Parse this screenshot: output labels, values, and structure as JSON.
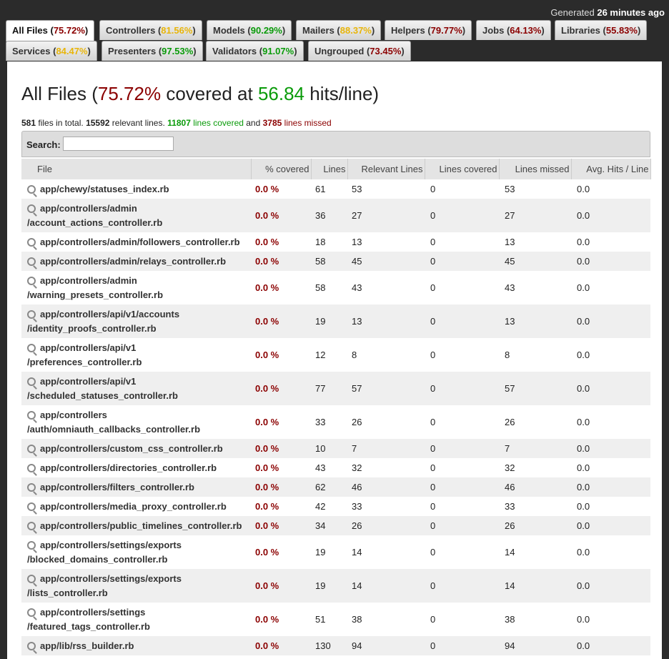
{
  "generated": {
    "prefix": "Generated ",
    "when": "26 minutes ago"
  },
  "tabs": [
    {
      "name": "All Files",
      "pct": "75.72%",
      "color": "red",
      "active": true
    },
    {
      "name": "Controllers",
      "pct": "81.56%",
      "color": "yel"
    },
    {
      "name": "Models",
      "pct": "90.29%",
      "color": "grn"
    },
    {
      "name": "Mailers",
      "pct": "88.37%",
      "color": "yel"
    },
    {
      "name": "Helpers",
      "pct": "79.77%",
      "color": "red"
    },
    {
      "name": "Jobs",
      "pct": "64.13%",
      "color": "red"
    },
    {
      "name": "Libraries",
      "pct": "55.83%",
      "color": "red"
    },
    {
      "name": "Services",
      "pct": "84.47%",
      "color": "yel"
    },
    {
      "name": "Presenters",
      "pct": "97.53%",
      "color": "grn"
    },
    {
      "name": "Validators",
      "pct": "91.07%",
      "color": "grn"
    },
    {
      "name": "Ungrouped",
      "pct": "73.45%",
      "color": "red"
    }
  ],
  "heading": {
    "prefix": "All Files (",
    "pct": "75.72%",
    "mid": " covered at ",
    "hits": "56.84",
    "suffix": " hits/line)"
  },
  "summary": {
    "files": "581",
    "files_label": " files in total. ",
    "relevant": "15592",
    "relevant_label": " relevant lines. ",
    "covered": "11807",
    "covered_label": " lines covered",
    "and": " and ",
    "missed": "3785",
    "missed_label": " lines missed"
  },
  "search": {
    "label": "Search:",
    "value": ""
  },
  "columns": [
    "File",
    "% covered",
    "Lines",
    "Relevant Lines",
    "Lines covered",
    "Lines missed",
    "Avg. Hits / Line"
  ],
  "rows": [
    {
      "file": [
        "app/chewy/statuses_index.rb"
      ],
      "cov": "0.0 %",
      "lines": "61",
      "rel": "53",
      "covd": "0",
      "miss": "53",
      "avg": "0.0"
    },
    {
      "file": [
        "app/controllers/admin",
        "/account_actions_controller.rb"
      ],
      "cov": "0.0 %",
      "lines": "36",
      "rel": "27",
      "covd": "0",
      "miss": "27",
      "avg": "0.0"
    },
    {
      "file": [
        "app/controllers/admin/followers_controller.rb"
      ],
      "cov": "0.0 %",
      "lines": "18",
      "rel": "13",
      "covd": "0",
      "miss": "13",
      "avg": "0.0"
    },
    {
      "file": [
        "app/controllers/admin/relays_controller.rb"
      ],
      "cov": "0.0 %",
      "lines": "58",
      "rel": "45",
      "covd": "0",
      "miss": "45",
      "avg": "0.0"
    },
    {
      "file": [
        "app/controllers/admin",
        "/warning_presets_controller.rb"
      ],
      "cov": "0.0 %",
      "lines": "58",
      "rel": "43",
      "covd": "0",
      "miss": "43",
      "avg": "0.0"
    },
    {
      "file": [
        "app/controllers/api/v1/accounts",
        "/identity_proofs_controller.rb"
      ],
      "cov": "0.0 %",
      "lines": "19",
      "rel": "13",
      "covd": "0",
      "miss": "13",
      "avg": "0.0"
    },
    {
      "file": [
        "app/controllers/api/v1",
        "/preferences_controller.rb"
      ],
      "cov": "0.0 %",
      "lines": "12",
      "rel": "8",
      "covd": "0",
      "miss": "8",
      "avg": "0.0"
    },
    {
      "file": [
        "app/controllers/api/v1",
        "/scheduled_statuses_controller.rb"
      ],
      "cov": "0.0 %",
      "lines": "77",
      "rel": "57",
      "covd": "0",
      "miss": "57",
      "avg": "0.0"
    },
    {
      "file": [
        "app/controllers",
        "/auth/omniauth_callbacks_controller.rb"
      ],
      "cov": "0.0 %",
      "lines": "33",
      "rel": "26",
      "covd": "0",
      "miss": "26",
      "avg": "0.0"
    },
    {
      "file": [
        "app/controllers/custom_css_controller.rb"
      ],
      "cov": "0.0 %",
      "lines": "10",
      "rel": "7",
      "covd": "0",
      "miss": "7",
      "avg": "0.0"
    },
    {
      "file": [
        "app/controllers/directories_controller.rb"
      ],
      "cov": "0.0 %",
      "lines": "43",
      "rel": "32",
      "covd": "0",
      "miss": "32",
      "avg": "0.0"
    },
    {
      "file": [
        "app/controllers/filters_controller.rb"
      ],
      "cov": "0.0 %",
      "lines": "62",
      "rel": "46",
      "covd": "0",
      "miss": "46",
      "avg": "0.0"
    },
    {
      "file": [
        "app/controllers/media_proxy_controller.rb"
      ],
      "cov": "0.0 %",
      "lines": "42",
      "rel": "33",
      "covd": "0",
      "miss": "33",
      "avg": "0.0"
    },
    {
      "file": [
        "app/controllers/public_timelines_controller.rb"
      ],
      "cov": "0.0 %",
      "lines": "34",
      "rel": "26",
      "covd": "0",
      "miss": "26",
      "avg": "0.0"
    },
    {
      "file": [
        "app/controllers/settings/exports",
        "/blocked_domains_controller.rb"
      ],
      "cov": "0.0 %",
      "lines": "19",
      "rel": "14",
      "covd": "0",
      "miss": "14",
      "avg": "0.0"
    },
    {
      "file": [
        "app/controllers/settings/exports",
        "/lists_controller.rb"
      ],
      "cov": "0.0 %",
      "lines": "19",
      "rel": "14",
      "covd": "0",
      "miss": "14",
      "avg": "0.0"
    },
    {
      "file": [
        "app/controllers/settings",
        "/featured_tags_controller.rb"
      ],
      "cov": "0.0 %",
      "lines": "51",
      "rel": "38",
      "covd": "0",
      "miss": "38",
      "avg": "0.0"
    },
    {
      "file": [
        "app/lib/rss_builder.rb"
      ],
      "cov": "0.0 %",
      "lines": "130",
      "rel": "94",
      "covd": "0",
      "miss": "94",
      "avg": "0.0"
    }
  ],
  "colors": {
    "red": "#8b0000",
    "yellow": "#e8b50a",
    "green": "#0a9b0a"
  }
}
